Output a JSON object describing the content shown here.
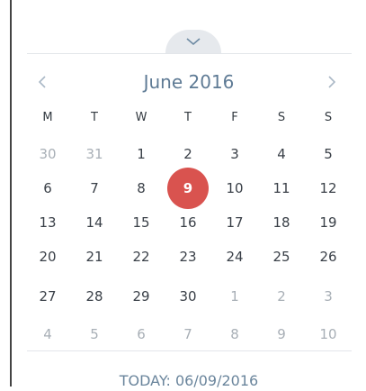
{
  "calendar": {
    "month_title": "June 2016",
    "weekdays": [
      "M",
      "T",
      "W",
      "T",
      "F",
      "S",
      "S"
    ],
    "weeks": [
      [
        {
          "day": "30",
          "muted": true
        },
        {
          "day": "31",
          "muted": true
        },
        {
          "day": "1"
        },
        {
          "day": "2"
        },
        {
          "day": "3"
        },
        {
          "day": "4"
        },
        {
          "day": "5"
        }
      ],
      [
        {
          "day": "6"
        },
        {
          "day": "7"
        },
        {
          "day": "8"
        },
        {
          "day": "9",
          "selected": true
        },
        {
          "day": "10"
        },
        {
          "day": "11"
        },
        {
          "day": "12"
        }
      ],
      [
        {
          "day": "13"
        },
        {
          "day": "14"
        },
        {
          "day": "15"
        },
        {
          "day": "16"
        },
        {
          "day": "17"
        },
        {
          "day": "18"
        },
        {
          "day": "19"
        }
      ],
      [
        {
          "day": "20"
        },
        {
          "day": "21"
        },
        {
          "day": "22"
        },
        {
          "day": "23"
        },
        {
          "day": "24"
        },
        {
          "day": "25"
        },
        {
          "day": "26"
        }
      ],
      [
        {
          "day": "27"
        },
        {
          "day": "28"
        },
        {
          "day": "29"
        },
        {
          "day": "30"
        },
        {
          "day": "1",
          "muted": true
        },
        {
          "day": "2",
          "muted": true
        },
        {
          "day": "3",
          "muted": true
        }
      ],
      [
        {
          "day": "4",
          "muted": true
        },
        {
          "day": "5",
          "muted": true
        },
        {
          "day": "6",
          "muted": true
        },
        {
          "day": "7",
          "muted": true
        },
        {
          "day": "8",
          "muted": true
        },
        {
          "day": "9",
          "muted": true
        },
        {
          "day": "10",
          "muted": true
        }
      ]
    ],
    "today_label": "TODAY: 06/09/2016"
  },
  "icons": {
    "collapse": "chevron-down-icon",
    "prev": "chevron-left-icon",
    "next": "chevron-right-icon"
  },
  "colors": {
    "selected": "#d9534f",
    "title": "#5f7b95",
    "muted_day": "#a8afb6"
  }
}
